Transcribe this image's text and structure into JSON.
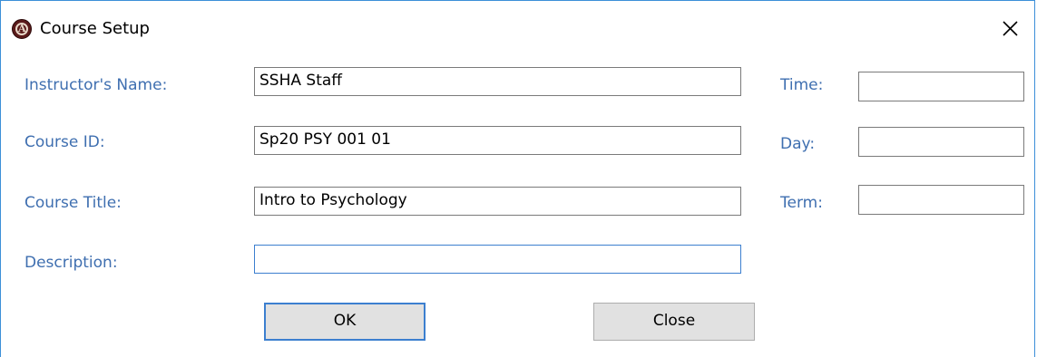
{
  "window": {
    "title": "Course Setup"
  },
  "form": {
    "instructor_label": "Instructor's Name:",
    "instructor_value": "SSHA Staff",
    "course_id_label": "Course ID:",
    "course_id_value": "Sp20 PSY 001 01",
    "course_title_label": "Course Title:",
    "course_title_value": "Intro to Psychology",
    "description_label": "Description:",
    "description_value": "",
    "time_label": "Time:",
    "time_value": "",
    "day_label": "Day:",
    "day_value": "",
    "term_label": "Term:",
    "term_value": ""
  },
  "buttons": {
    "ok_label": "OK",
    "close_label": "Close"
  },
  "icons": {
    "app": "app-logo-icon",
    "close": "close-icon"
  },
  "colors": {
    "label_text": "#3f6fb0",
    "window_border": "#3c8fd8",
    "focus_border": "#3c7fcf",
    "button_bg": "#e1e1e1"
  }
}
